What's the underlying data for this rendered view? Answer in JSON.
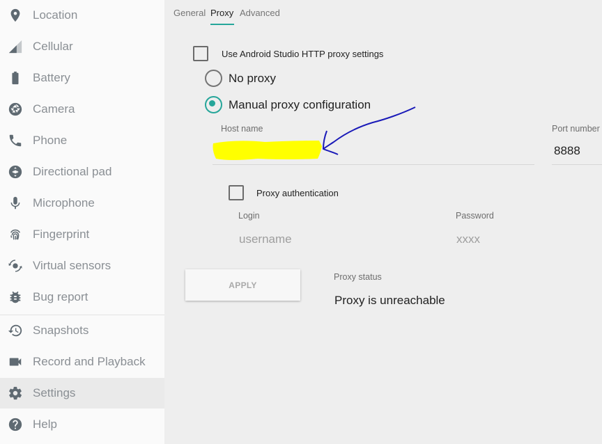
{
  "sidebar": {
    "items": [
      {
        "label": "Location",
        "icon": "location-pin-icon"
      },
      {
        "label": "Cellular",
        "icon": "cellular-signal-icon"
      },
      {
        "label": "Battery",
        "icon": "battery-icon"
      },
      {
        "label": "Camera",
        "icon": "camera-aperture-icon"
      },
      {
        "label": "Phone",
        "icon": "phone-icon"
      },
      {
        "label": "Directional pad",
        "icon": "dpad-icon"
      },
      {
        "label": "Microphone",
        "icon": "microphone-icon"
      },
      {
        "label": "Fingerprint",
        "icon": "fingerprint-icon"
      },
      {
        "label": "Virtual sensors",
        "icon": "rotation-icon"
      },
      {
        "label": "Bug report",
        "icon": "bug-icon"
      },
      {
        "label": "Snapshots",
        "icon": "history-icon"
      },
      {
        "label": "Record and Playback",
        "icon": "videocam-icon"
      },
      {
        "label": "Settings",
        "icon": "gear-icon"
      },
      {
        "label": "Help",
        "icon": "help-icon"
      }
    ],
    "active_item": "Settings"
  },
  "tabs": [
    {
      "label": "General"
    },
    {
      "label": "Proxy"
    },
    {
      "label": "Advanced"
    }
  ],
  "active_tab": "Proxy",
  "proxy": {
    "use_studio_label": "Use Android Studio HTTP proxy settings",
    "use_studio_checked": false,
    "no_proxy_label": "No proxy",
    "manual_label": "Manual proxy configuration",
    "selected_mode": "manual",
    "host_label": "Host name",
    "host_value": "",
    "port_label": "Port number",
    "port_value": "8888",
    "auth_label": "Proxy authentication",
    "auth_checked": false,
    "login_label": "Login",
    "login_placeholder": "username",
    "password_label": "Password",
    "password_placeholder": "xxxx",
    "apply_label": "APPLY",
    "status_label": "Proxy status",
    "status_value": "Proxy is unreachable"
  },
  "colors": {
    "accent": "#26a69a",
    "highlight": "#ffff00",
    "annotation_arrow": "#1a1ab8"
  }
}
